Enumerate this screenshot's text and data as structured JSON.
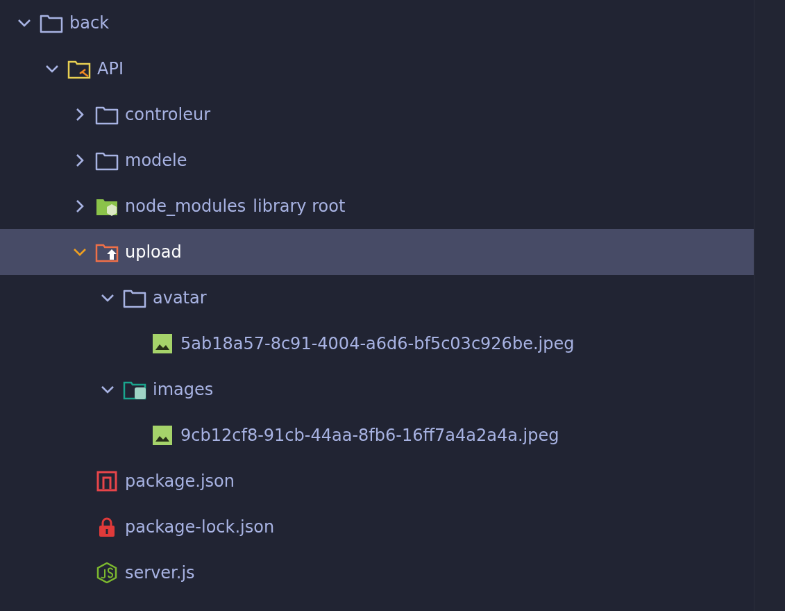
{
  "tree": [
    {
      "name": "back",
      "kind": "folder",
      "expanded": true,
      "selected": false,
      "children": [
        {
          "name": "API",
          "kind": "api-folder",
          "expanded": true,
          "selected": false,
          "children": [
            {
              "name": "controleur",
              "kind": "folder",
              "expanded": false,
              "selected": false
            },
            {
              "name": "modele",
              "kind": "folder",
              "expanded": false,
              "selected": false
            },
            {
              "name": "node_modules",
              "note": "library root",
              "kind": "node-folder",
              "expanded": false,
              "selected": false
            },
            {
              "name": "upload",
              "kind": "upload-folder",
              "expanded": true,
              "selected": true,
              "children": [
                {
                  "name": "avatar",
                  "kind": "folder",
                  "expanded": true,
                  "selected": false,
                  "children": [
                    {
                      "name": "5ab18a57-8c91-4004-a6d6-bf5c03c926be.jpeg",
                      "kind": "image-file",
                      "selected": false
                    }
                  ]
                },
                {
                  "name": "images",
                  "kind": "images-folder",
                  "expanded": true,
                  "selected": false,
                  "children": [
                    {
                      "name": "9cb12cf8-91cb-44aa-8fb6-16ff7a4a2a4a.jpeg",
                      "kind": "image-file",
                      "selected": false
                    }
                  ]
                }
              ]
            },
            {
              "name": "package.json",
              "kind": "npm-file",
              "selected": false
            },
            {
              "name": "package-lock.json",
              "kind": "lock-file",
              "selected": false
            },
            {
              "name": "server.js",
              "kind": "node-js-file",
              "selected": false
            }
          ]
        }
      ]
    }
  ]
}
